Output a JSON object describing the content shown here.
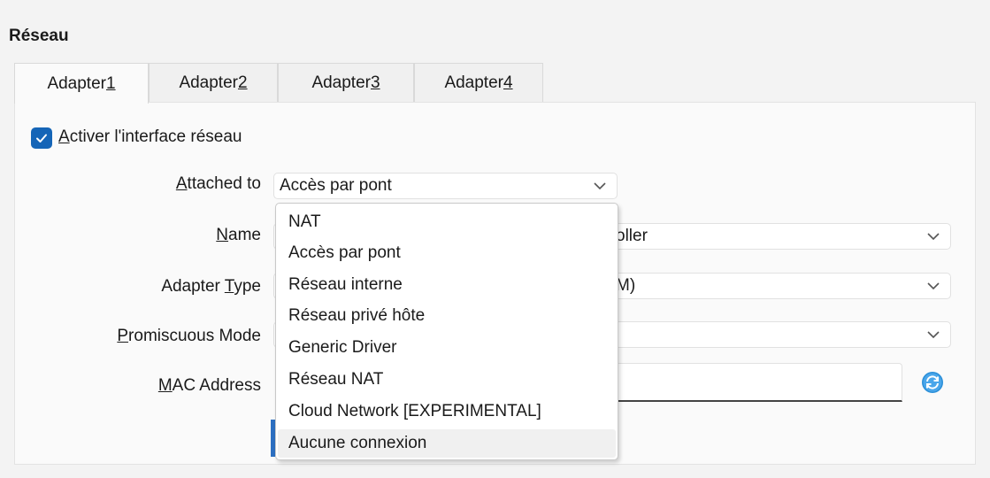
{
  "section_title": "Réseau",
  "tabs": [
    {
      "label": "Adapter ",
      "key": "1",
      "active": true
    },
    {
      "label": "Adapter ",
      "key": "2",
      "active": false
    },
    {
      "label": "Adapter ",
      "key": "3",
      "active": false
    },
    {
      "label": "Adapter ",
      "key": "4",
      "active": false
    }
  ],
  "enable": {
    "checked": true,
    "key": "A",
    "label_rest": "ctiver l'interface réseau"
  },
  "fields": {
    "attached_to": {
      "key": "A",
      "label_rest": "ttached to",
      "value": "Accès par pont"
    },
    "name": {
      "key": "N",
      "label_rest": "ame",
      "value": "oller"
    },
    "adapter_type": {
      "label_pre": "Adapter ",
      "key": "T",
      "label_rest": "ype",
      "value": "M)"
    },
    "promiscuous_mode": {
      "key": "P",
      "label_rest": "romiscuous Mode",
      "value": ""
    },
    "mac_address": {
      "key": "M",
      "label_rest": "AC Address",
      "value": ""
    }
  },
  "dropdown": {
    "options": [
      "NAT",
      "Accès par pont",
      "Réseau interne",
      "Réseau privé hôte",
      "Generic Driver",
      "Réseau NAT",
      "Cloud Network [EXPERIMENTAL]",
      "Aucune connexion"
    ],
    "highlighted": "Aucune connexion"
  },
  "icons": {
    "checkbox": "checkmark-icon",
    "combo": "chevron-down-icon",
    "mac": "refresh-icon"
  },
  "colors": {
    "accent": "#1565b7",
    "refresh": "#2b8fd8"
  }
}
